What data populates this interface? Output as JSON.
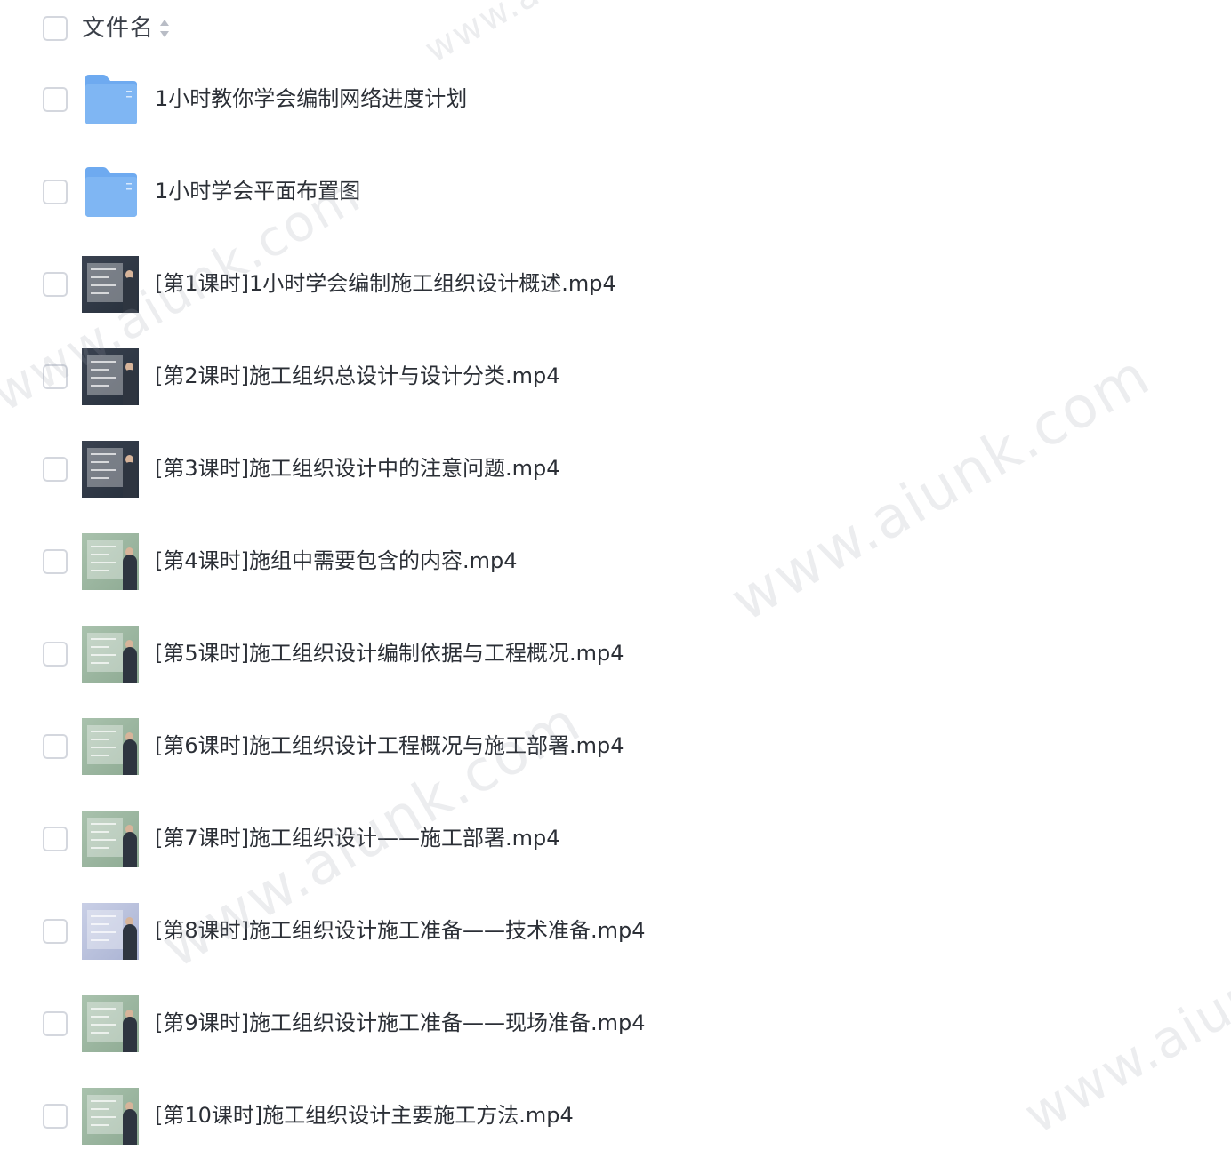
{
  "header": {
    "column_label": "文件名"
  },
  "files": [
    {
      "name": "1小时教你学会编制网络进度计划",
      "type": "folder-icon"
    },
    {
      "name": "1小时学会平面布置图",
      "type": "folder-icon"
    },
    {
      "name": "[第1课时]1小时学会编制施工组织设计概述.mp4",
      "type": "video-thumbnail",
      "style": "dark"
    },
    {
      "name": "[第2课时]施工组织总设计与设计分类.mp4",
      "type": "video-thumbnail",
      "style": "dark"
    },
    {
      "name": "[第3课时]施工组织设计中的注意问题.mp4",
      "type": "video-thumbnail",
      "style": "dark"
    },
    {
      "name": "[第4课时]施组中需要包含的内容.mp4",
      "type": "video-thumbnail",
      "style": "green"
    },
    {
      "name": "[第5课时]施工组织设计编制依据与工程概况.mp4",
      "type": "video-thumbnail",
      "style": "green"
    },
    {
      "name": "[第6课时]施工组织设计工程概况与施工部署.mp4",
      "type": "video-thumbnail",
      "style": "green"
    },
    {
      "name": "[第7课时]施工组织设计——施工部署.mp4",
      "type": "video-thumbnail",
      "style": "green"
    },
    {
      "name": "[第8课时]施工组织设计施工准备——技术准备.mp4",
      "type": "video-thumbnail",
      "style": "lavender"
    },
    {
      "name": "[第9课时]施工组织设计施工准备——现场准备.mp4",
      "type": "video-thumbnail",
      "style": "green"
    },
    {
      "name": "[第10课时]施工组织设计主要施工方法.mp4",
      "type": "video-thumbnail",
      "style": "green"
    }
  ],
  "watermark_text": "www.aiunk.com",
  "colors": {
    "folder": "#7fb6f3",
    "checkbox_border": "#d4d7de",
    "text": "#2b2f36"
  }
}
